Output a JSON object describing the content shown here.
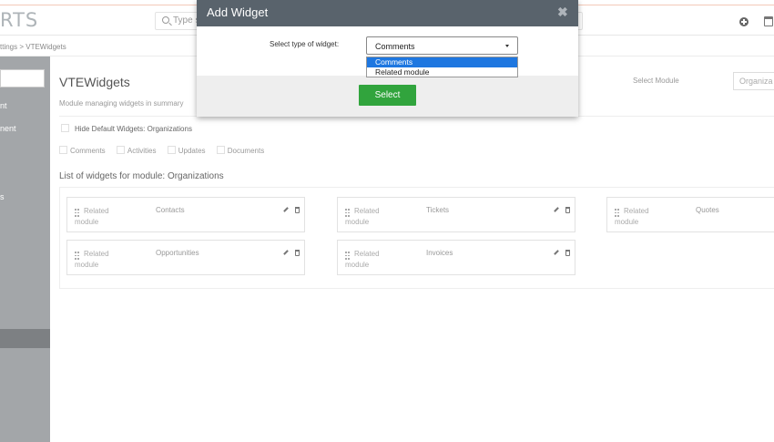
{
  "header": {
    "logo_text": "RTS",
    "search_placeholder": "Type s",
    "icons": [
      "plus-circle-icon",
      "calendar-icon"
    ]
  },
  "breadcrumb": {
    "text": "ttings > VTEWidgets"
  },
  "sidebar": {
    "items": [
      {
        "label": "nt"
      },
      {
        "label": "nent"
      },
      {
        "label": "s"
      }
    ]
  },
  "main": {
    "title": "VTEWidgets",
    "description": "Module managing widgets in summary",
    "select_module_label": "Select Module",
    "select_module_value": "Organiza",
    "hide_default_label": "Hide Default Widgets: Organizations",
    "widget_types": [
      "Comments",
      "Activities",
      "Updates",
      "Documents"
    ],
    "list_title": "List of widgets for module: Organizations",
    "cards": [
      {
        "type": "Related module",
        "name": "Contacts"
      },
      {
        "type": "Related module",
        "name": "Tickets"
      },
      {
        "type": "Related module",
        "name": "Quotes"
      },
      {
        "type": "Related module",
        "name": "Opportunities"
      },
      {
        "type": "Related module",
        "name": "Invoices"
      }
    ]
  },
  "modal": {
    "title": "Add Widget",
    "close_glyph": "✖",
    "label": "Select type of widget:",
    "selected_value": "Comments",
    "options": [
      "Comments",
      "Related module"
    ],
    "highlighted_option": "Comments",
    "button_label": "Select"
  },
  "colors": {
    "modal_header": "#59636c",
    "select_button": "#31a43d",
    "option_highlight": "#1e77e0",
    "sidebar": "#a3a6a9"
  }
}
